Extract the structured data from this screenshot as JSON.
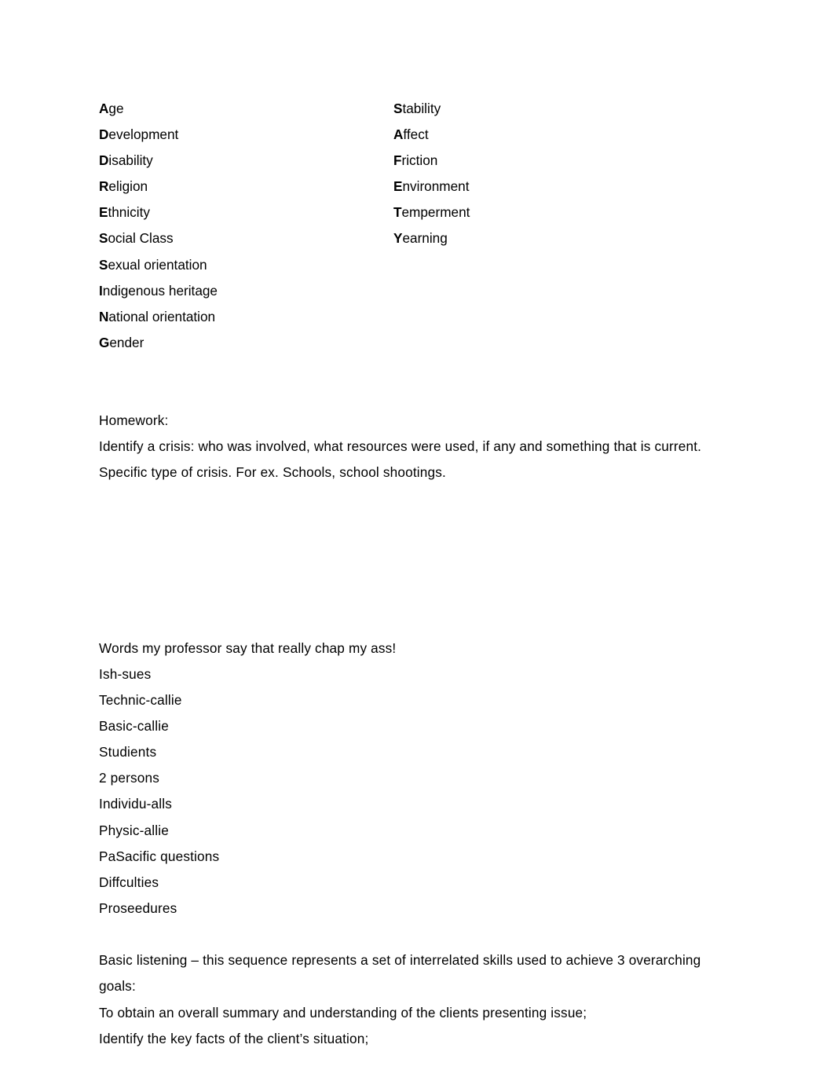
{
  "document": {
    "background_color": "#ffffff",
    "text_color": "#000000",
    "acronym_lists": {
      "left_column": [
        {
          "cap": "A",
          "rest": "ge"
        },
        {
          "cap": "D",
          "rest": "evelopment"
        },
        {
          "cap": "D",
          "rest": "isability"
        },
        {
          "cap": "R",
          "rest": "eligion"
        },
        {
          "cap": "E",
          "rest": "thnicity"
        },
        {
          "cap": "S",
          "rest": "ocial Class"
        },
        {
          "cap": "S",
          "rest": "exual orientation"
        },
        {
          "cap": "I",
          "rest": "ndigenous heritage"
        },
        {
          "cap": "N",
          "rest": "ational orientation"
        },
        {
          "cap": "G",
          "rest": "ender"
        }
      ],
      "right_column": [
        {
          "cap": "S",
          "rest": "tability"
        },
        {
          "cap": "A",
          "rest": "ffect"
        },
        {
          "cap": "F",
          "rest": "riction"
        },
        {
          "cap": "E",
          "rest": "nvironment"
        },
        {
          "cap": "T",
          "rest": "emperment"
        },
        {
          "cap": "Y",
          "rest": "earning"
        }
      ]
    },
    "homework": {
      "heading": "Homework:",
      "body": "Identify a crisis: who was involved, what resources were used, if any and something that is current. Specific type of crisis. For ex. Schools, school shootings."
    },
    "professor_words": {
      "heading": "Words my professor say that really chap my ass!",
      "items": [
        "Ish-sues",
        "Technic-callie",
        "Basic-callie",
        "Studients",
        "2 persons",
        "Individu-alls",
        "Physic-allie",
        "PaSacific questions",
        "Diffculties",
        "Proseedures"
      ]
    },
    "basic_listening": {
      "intro": "Basic listening – this sequence represents a set of interrelated skills used to achieve 3 overarching goals:",
      "goals": [
        "To obtain an overall summary and understanding of the clients presenting issue;",
        "Identify the key facts of the client’s situation;"
      ]
    }
  }
}
